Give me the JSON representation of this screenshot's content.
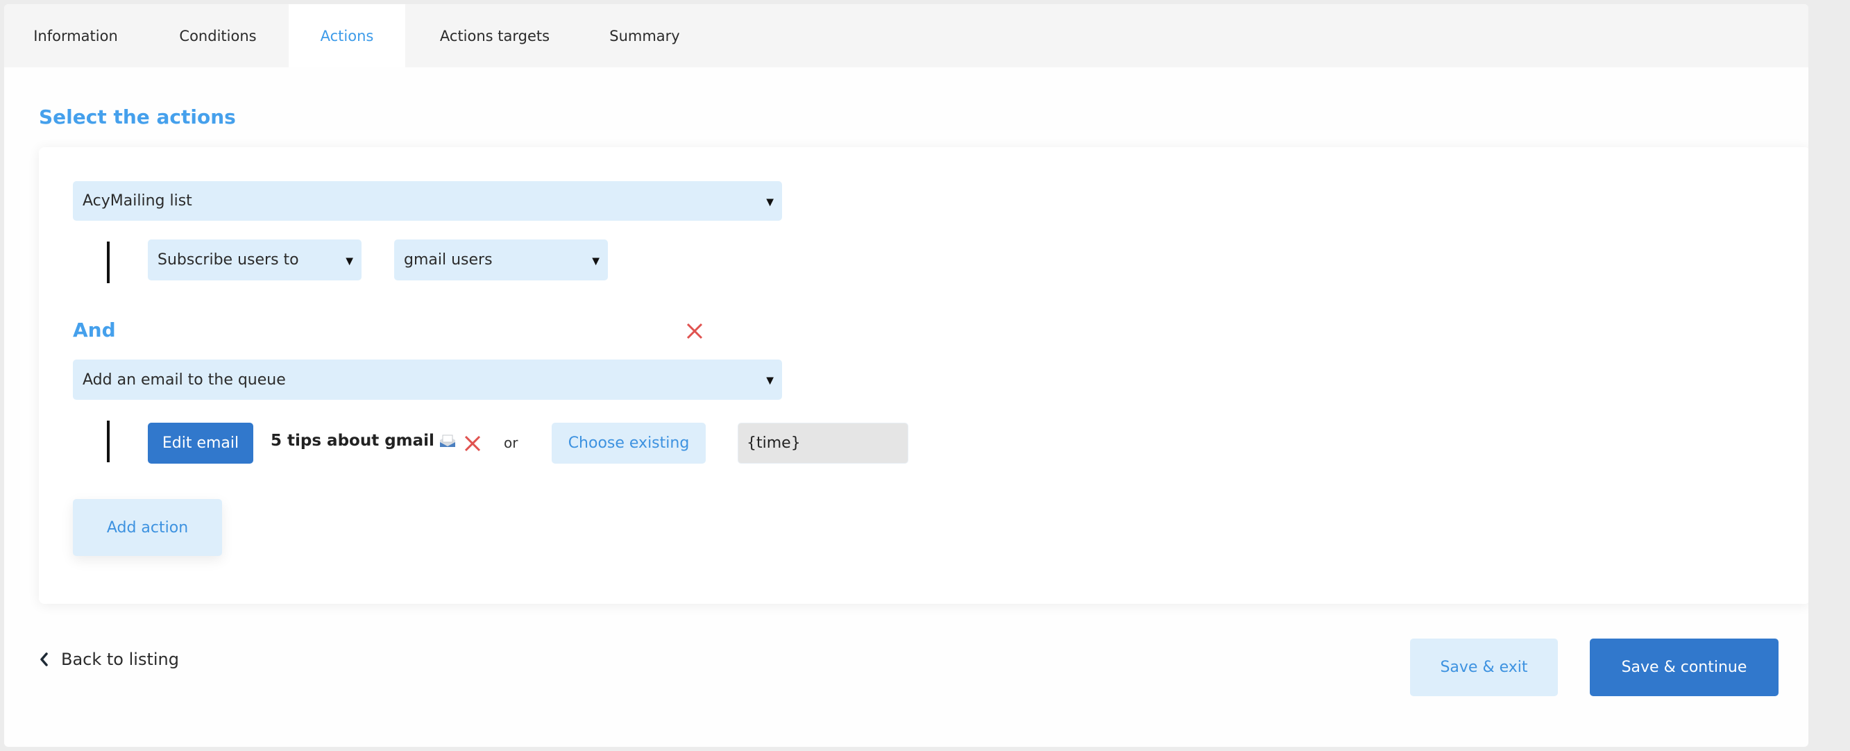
{
  "tabs": [
    {
      "label": "Information",
      "active": false
    },
    {
      "label": "Conditions",
      "active": false
    },
    {
      "label": "Actions",
      "active": true
    },
    {
      "label": "Actions targets",
      "active": false
    },
    {
      "label": "Summary",
      "active": false
    }
  ],
  "section_title": "Select the actions",
  "actions": [
    {
      "type_select": "AcyMailing list",
      "sub": {
        "operation_select": "Subscribe users to",
        "list_select": "gmail users"
      }
    },
    {
      "connector": "And",
      "type_select": "Add an email to the queue",
      "sub": {
        "edit_button": "Edit email",
        "email_title": "5 tips about gmail",
        "email_icon": "envelope-tray-icon",
        "or_label": "or",
        "choose_button": "Choose existing",
        "time_value": "{time}"
      }
    }
  ],
  "add_action_label": "Add action",
  "footer": {
    "back_label": "Back to listing",
    "save_exit_label": "Save & exit",
    "save_continue_label": "Save & continue"
  },
  "colors": {
    "accent": "#45a0ec",
    "primary_button": "#3178cc",
    "light_button": "#ddeefb",
    "delete": "#e0524f"
  }
}
